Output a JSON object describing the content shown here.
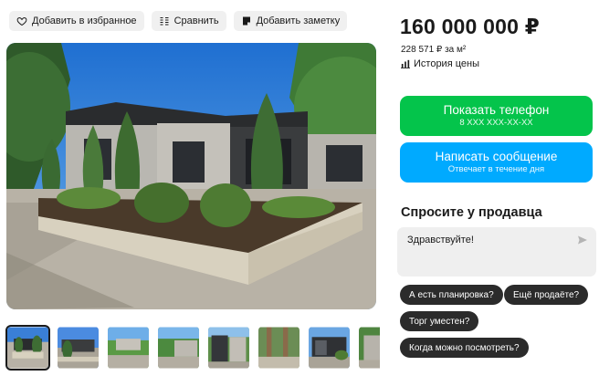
{
  "toolbar": {
    "favorite_label": "Добавить в избранное",
    "compare_label": "Сравнить",
    "note_label": "Добавить заметку"
  },
  "listing": {
    "price": "160 000 000 ₽",
    "price_per_m2": "228 571 ₽ за м²",
    "price_history_label": "История цены"
  },
  "actions": {
    "phone_label": "Показать телефон",
    "phone_masked": "8 XXX XXX-XX-XX",
    "message_label": "Написать сообщение",
    "message_sub": "Отвечает в течение дня"
  },
  "ask_seller": {
    "title": "Спросите у продавца",
    "message_value": "Здравствуйте!",
    "quick_questions": [
      "А есть планировка?",
      "Ещё продаёте?",
      "Торг уместен?",
      "Когда можно посмотреть?"
    ]
  },
  "gallery": {
    "thumbnail_count_visible": 8,
    "active_index": 0
  },
  "colors": {
    "phone_button": "#04c44b",
    "message_button": "#00aaff",
    "chip_bg": "#2b2b2b"
  }
}
